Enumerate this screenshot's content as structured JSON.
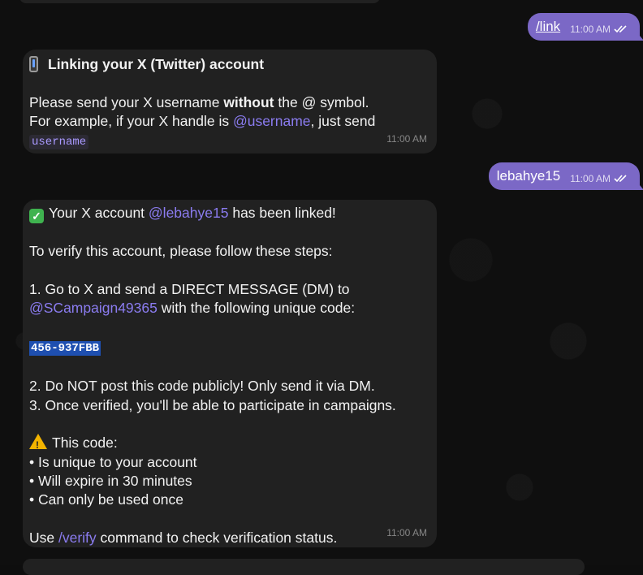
{
  "messages": {
    "out1": {
      "text": "/link",
      "time": "11:00 AM"
    },
    "in1": {
      "title": "Linking your X (Twitter) account",
      "line1_pre": "Please send your X username ",
      "line1_bold": "without",
      "line1_post": " the @ symbol.",
      "line2_pre": "For example, if your X handle is ",
      "line2_mention": "@username",
      "line2_post": ", just send",
      "code": "username",
      "time": "11:00 AM"
    },
    "out2": {
      "text": "lebahye15",
      "time": "11:00 AM"
    },
    "in2": {
      "title_pre": "Your X account ",
      "title_mention": "@lebahye15",
      "title_post": " has been linked!",
      "intro": "To verify this account, please follow these steps:",
      "step1a": "1. Go to X and send a DIRECT MESSAGE (DM) to",
      "step1_mention": "@SCampaign49365",
      "step1b": " with the following unique code:",
      "code": "456-937FBB",
      "step2": "2. Do NOT post this code publicly! Only send it via DM.",
      "step3": "3. Once verified, you'll be able to participate in campaigns.",
      "warn_title": "This code:",
      "bullet1": "• Is unique to your account",
      "bullet2": "• Will expire in 30 minutes",
      "bullet3": "• Can only be used once",
      "footer_pre": "Use ",
      "footer_cmd": "/verify",
      "footer_post": " command to check verification status.",
      "time": "11:00 AM"
    }
  },
  "icons": {
    "phone": "mobile-phone-icon",
    "check": "check-mark-icon",
    "warning": "warning-icon",
    "read": "double-check-icon"
  },
  "colors": {
    "outgoing_bubble": "#7b68c6",
    "incoming_bubble": "#212121",
    "mention": "#8b7cf0",
    "background": "#0f0f0f"
  }
}
